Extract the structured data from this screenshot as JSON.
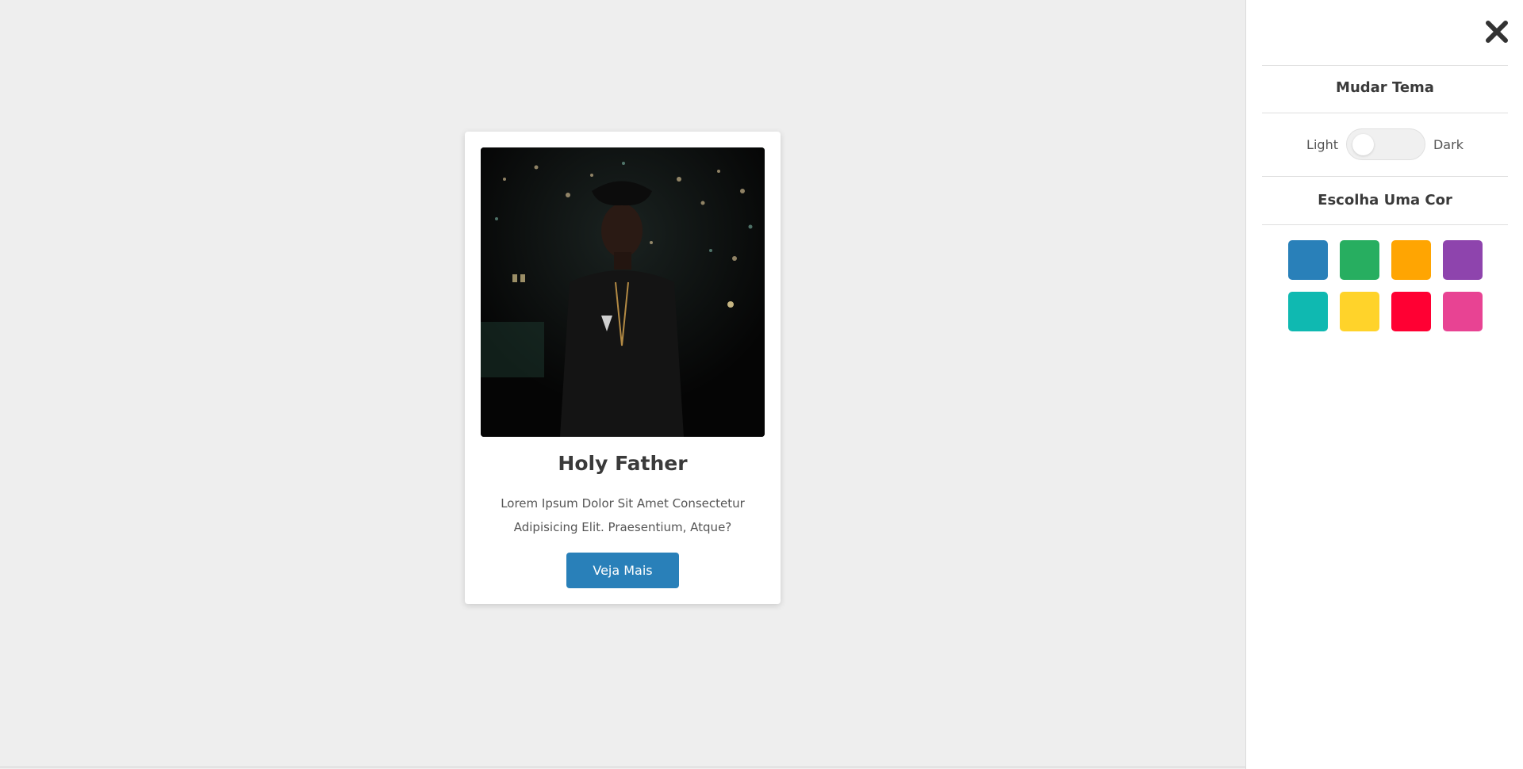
{
  "card": {
    "title": "Holy Father",
    "description": "Lorem Ipsum Dolor Sit Amet Consectetur Adipisicing Elit. Praesentium, Atque?",
    "button_label": "Veja Mais",
    "button_color": "#2980b9"
  },
  "panel": {
    "close_icon": "close-icon",
    "theme_heading": "Mudar Tema",
    "light_label": "Light",
    "dark_label": "Dark",
    "theme_toggle_on": false,
    "color_heading": "Escolha Uma Cor",
    "colors": [
      "#2980b9",
      "#27ae60",
      "#ffa502",
      "#8e44ad",
      "#0fb9b1",
      "#ffd32a",
      "#ff0033",
      "#e84393"
    ]
  }
}
